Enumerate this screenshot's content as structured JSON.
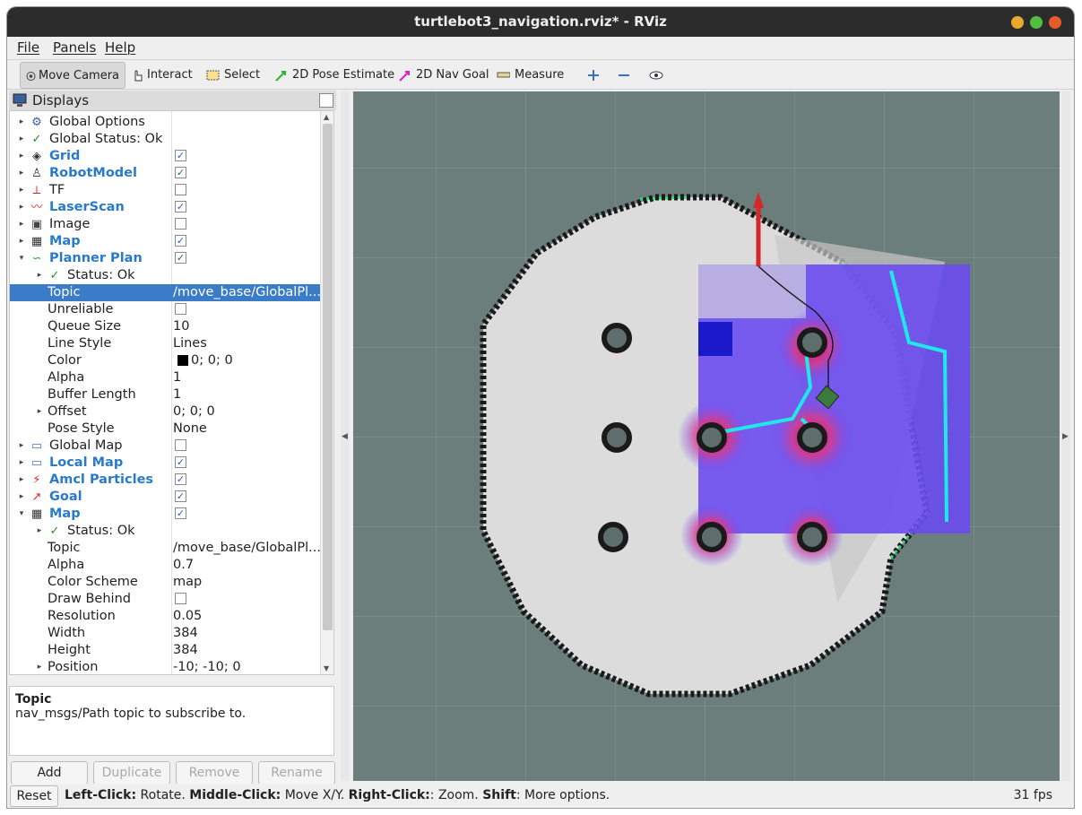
{
  "window": {
    "title": "turtlebot3_navigation.rviz* - RViz"
  },
  "menu": {
    "file": "File",
    "panels": "Panels",
    "help": "Help"
  },
  "toolbar": {
    "move_camera": "Move Camera",
    "interact": "Interact",
    "select": "Select",
    "pose_estimate": "2D Pose Estimate",
    "nav_goal": "2D Nav Goal",
    "measure": "Measure"
  },
  "displays": {
    "title": "Displays",
    "rows": [
      {
        "name": "Global Options",
        "value": "",
        "check": null
      },
      {
        "name": "Global Status: Ok",
        "value": "",
        "check": null
      },
      {
        "name": "Grid",
        "value": "",
        "check": true
      },
      {
        "name": "RobotModel",
        "value": "",
        "check": true
      },
      {
        "name": "TF",
        "value": "",
        "check": false
      },
      {
        "name": "LaserScan",
        "value": "",
        "check": true
      },
      {
        "name": "Image",
        "value": "",
        "check": false
      },
      {
        "name": "Map",
        "value": "",
        "check": true
      },
      {
        "name": "Planner Plan",
        "value": "",
        "check": true
      },
      {
        "name": "Status: Ok",
        "value": "",
        "check": null
      },
      {
        "name": "Topic",
        "value": "/move_base/GlobalPl...",
        "check": null
      },
      {
        "name": "Unreliable",
        "value": "",
        "check": false
      },
      {
        "name": "Queue Size",
        "value": "10",
        "check": null
      },
      {
        "name": "Line Style",
        "value": "Lines",
        "check": null
      },
      {
        "name": "Color",
        "value": "0; 0; 0",
        "check": null
      },
      {
        "name": "Alpha",
        "value": "1",
        "check": null
      },
      {
        "name": "Buffer Length",
        "value": "1",
        "check": null
      },
      {
        "name": "Offset",
        "value": "0; 0; 0",
        "check": null
      },
      {
        "name": "Pose Style",
        "value": "None",
        "check": null
      },
      {
        "name": "Global Map",
        "value": "",
        "check": false
      },
      {
        "name": "Local Map",
        "value": "",
        "check": true
      },
      {
        "name": "Amcl Particles",
        "value": "",
        "check": true
      },
      {
        "name": "Goal",
        "value": "",
        "check": true
      },
      {
        "name": "Map",
        "value": "",
        "check": true
      },
      {
        "name": "Status: Ok",
        "value": "",
        "check": null
      },
      {
        "name": "Topic",
        "value": "/move_base/GlobalPl...",
        "check": null
      },
      {
        "name": "Alpha",
        "value": "0.7",
        "check": null
      },
      {
        "name": "Color Scheme",
        "value": "map",
        "check": null
      },
      {
        "name": "Draw Behind",
        "value": "",
        "check": false
      },
      {
        "name": "Resolution",
        "value": "0.05",
        "check": null
      },
      {
        "name": "Width",
        "value": "384",
        "check": null
      },
      {
        "name": "Height",
        "value": "384",
        "check": null
      },
      {
        "name": "Position",
        "value": "-10; -10; 0",
        "check": null
      }
    ]
  },
  "description": {
    "title": "Topic",
    "text": "nav_msgs/Path topic to subscribe to."
  },
  "buttons": {
    "add": "Add",
    "duplicate": "Duplicate",
    "remove": "Remove",
    "rename": "Rename"
  },
  "status": {
    "reset": "Reset",
    "lclick": "Left-Click:",
    "lclick_t": " Rotate. ",
    "mclick": "Middle-Click:",
    "mclick_t": " Move X/Y. ",
    "rclick": "Right-Click:",
    "rclick_t": ": Zoom. ",
    "shift": "Shift",
    "shift_t": ": More options.",
    "fps": "31 fps"
  },
  "colors": {
    "accent": "#3a7cc7",
    "title_blue": "#2a7acb",
    "viewport_bg": "#6b7e7b"
  }
}
